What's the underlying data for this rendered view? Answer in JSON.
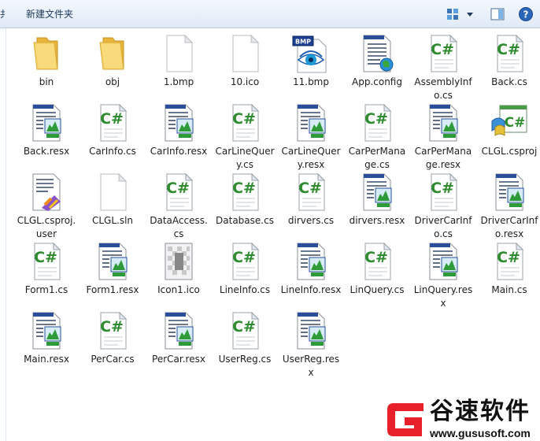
{
  "toolbar": {
    "partial_label": "共享",
    "new_folder_label": "新建文件夹",
    "views_icon": "view-options-icon",
    "preview_icon": "preview-pane-icon",
    "help_icon": "help-icon"
  },
  "files": [
    {
      "name": "bin",
      "icon": "folder"
    },
    {
      "name": "obj",
      "icon": "folder"
    },
    {
      "name": "1.bmp",
      "icon": "blank"
    },
    {
      "name": "10.ico",
      "icon": "blank"
    },
    {
      "name": "11.bmp",
      "icon": "bmp"
    },
    {
      "name": "App.config",
      "icon": "config"
    },
    {
      "name": "AssemblyInfo.cs",
      "icon": "cs"
    },
    {
      "name": "Back.cs",
      "icon": "cs"
    },
    {
      "name": "Back.resx",
      "icon": "resx"
    },
    {
      "name": "CarInfo.cs",
      "icon": "cs"
    },
    {
      "name": "CarInfo.resx",
      "icon": "resx"
    },
    {
      "name": "CarLineQuery.cs",
      "icon": "cs"
    },
    {
      "name": "CarLineQuery.resx",
      "icon": "resx"
    },
    {
      "name": "CarPerManage.cs",
      "icon": "cs"
    },
    {
      "name": "CarPerManage.resx",
      "icon": "resx"
    },
    {
      "name": "CLGL.csproj",
      "icon": "csproj"
    },
    {
      "name": "CLGL.csproj.user",
      "icon": "user"
    },
    {
      "name": "CLGL.sln",
      "icon": "blank"
    },
    {
      "name": "DataAccess.cs",
      "icon": "cs"
    },
    {
      "name": "Database.cs",
      "icon": "cs"
    },
    {
      "name": "dirvers.cs",
      "icon": "cs"
    },
    {
      "name": "dirvers.resx",
      "icon": "resx"
    },
    {
      "name": "DriverCarInfo.cs",
      "icon": "cs"
    },
    {
      "name": "DriverCarInfo.resx",
      "icon": "resx"
    },
    {
      "name": "Form1.cs",
      "icon": "cs"
    },
    {
      "name": "Form1.resx",
      "icon": "resx"
    },
    {
      "name": "Icon1.ico",
      "icon": "ico"
    },
    {
      "name": "LineInfo.cs",
      "icon": "cs"
    },
    {
      "name": "LineInfo.resx",
      "icon": "resx"
    },
    {
      "name": "LinQuery.cs",
      "icon": "cs"
    },
    {
      "name": "LinQuery.resx",
      "icon": "resx"
    },
    {
      "name": "Main.cs",
      "icon": "cs"
    },
    {
      "name": "Main.resx",
      "icon": "resx"
    },
    {
      "name": "PerCar.cs",
      "icon": "cs"
    },
    {
      "name": "PerCar.resx",
      "icon": "resx"
    },
    {
      "name": "UserReg.cs",
      "icon": "cs"
    },
    {
      "name": "UserReg.resx",
      "icon": "resx"
    }
  ],
  "watermark": {
    "brand": "谷速软件",
    "url": "www.gususoft.com",
    "accent": "#e8202a"
  },
  "colors": {
    "toolbar_text": "#1e395b",
    "cs_green": "#2e8b2e",
    "folder_yellow": "#f3c44f"
  }
}
